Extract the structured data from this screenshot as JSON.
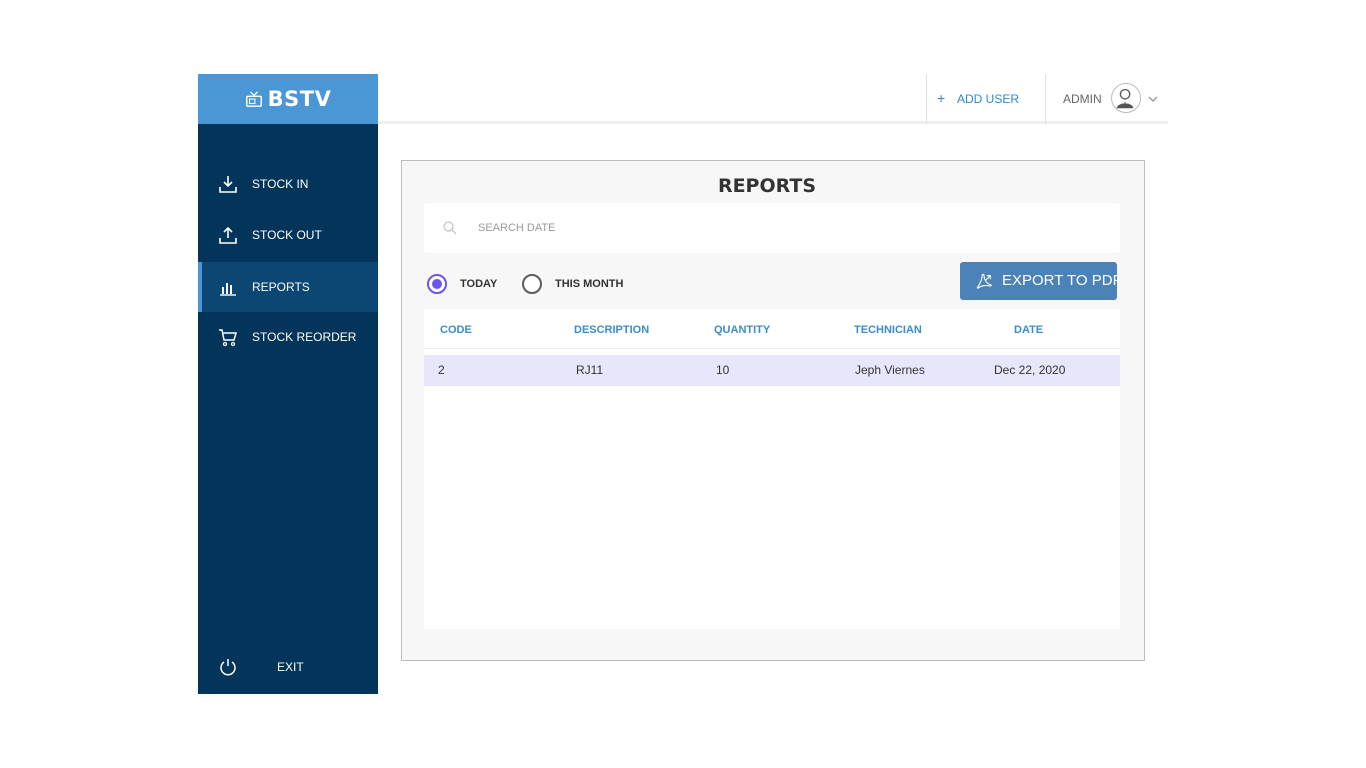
{
  "brand": {
    "name": "BSTV",
    "icon": "tv-icon"
  },
  "sidebar": {
    "items": [
      {
        "label": "STOCK IN",
        "icon": "download-icon",
        "active": false
      },
      {
        "label": "STOCK OUT",
        "icon": "upload-icon",
        "active": false
      },
      {
        "label": "REPORTS",
        "icon": "bar-chart-icon",
        "active": true
      },
      {
        "label": "STOCK REORDER",
        "icon": "cart-icon",
        "active": false
      }
    ],
    "exit": {
      "label": "EXIT",
      "icon": "power-icon"
    }
  },
  "topbar": {
    "add_user": {
      "plus": "+",
      "label": "ADD USER",
      "icon": "plus-icon"
    },
    "admin_label": "ADMIN",
    "avatar_icon": "user-avatar-icon",
    "chevron_icon": "chevron-down-icon"
  },
  "report": {
    "title": "REPORTS",
    "search": {
      "placeholder": "SEARCH DATE",
      "value": "",
      "icon": "search-icon"
    },
    "filters": [
      {
        "label": "TODAY",
        "checked": true
      },
      {
        "label": "THIS MONTH",
        "checked": false
      }
    ],
    "export_label": "EXPORT TO PDF",
    "export_icon": "pdf-icon",
    "table": {
      "columns": [
        "CODE",
        "DESCRIPTION",
        "QUANTITY",
        "TECHNICIAN",
        "DATE"
      ],
      "rows": [
        {
          "code": "2",
          "description": "RJ11",
          "quantity": "10",
          "technician": "Jeph Viernes",
          "date": "Dec 22, 2020"
        }
      ]
    }
  },
  "colors": {
    "sidebar_bg": "#033459",
    "brand_bg": "#4b97d5",
    "active_item_bg": "#0c4673",
    "accent_blue": "#2d8bc9",
    "export_button": "#4b83b9",
    "radio_checked": "#6a55f0",
    "row_highlight": "#e8e6fb"
  }
}
